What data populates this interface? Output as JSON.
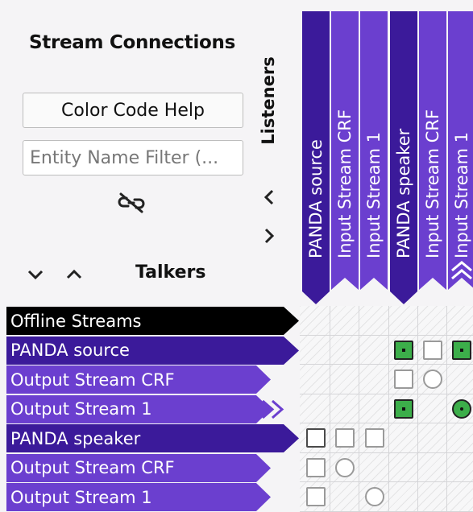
{
  "panel": {
    "title": "Stream Connections",
    "color_code_help_label": "Color Code Help",
    "filter_placeholder": "Entity Name Filter (...",
    "listeners_label": "Listeners",
    "talkers_label": "Talkers"
  },
  "listeners": [
    {
      "label": "PANDA source",
      "color": "#3b1a9a",
      "kind": "entity"
    },
    {
      "label": "Input Stream CRF",
      "color": "#6b3fcf",
      "kind": "stream"
    },
    {
      "label": "Input Stream 1",
      "color": "#6b3fcf",
      "kind": "stream"
    },
    {
      "label": "PANDA speaker",
      "color": "#3b1a9a",
      "kind": "entity"
    },
    {
      "label": "Input Stream CRF",
      "color": "#6b3fcf",
      "kind": "stream"
    },
    {
      "label": "Input Stream 1",
      "color": "#6b3fcf",
      "kind": "stream"
    }
  ],
  "talkers": [
    {
      "label": "Offline Streams",
      "color": "#000000",
      "kind": "offline"
    },
    {
      "label": "PANDA source",
      "color": "#3b1a9a",
      "kind": "entity"
    },
    {
      "label": "Output Stream CRF",
      "color": "#6b3fcf",
      "kind": "stream"
    },
    {
      "label": "Output Stream 1",
      "color": "#6b3fcf",
      "kind": "stream"
    },
    {
      "label": "PANDA speaker",
      "color": "#3b1a9a",
      "kind": "entity"
    },
    {
      "label": "Output Stream CRF",
      "color": "#6b3fcf",
      "kind": "stream"
    },
    {
      "label": "Output Stream 1",
      "color": "#6b3fcf",
      "kind": "stream"
    }
  ],
  "cells": [
    {
      "row": 1,
      "col": 3,
      "shape": "square",
      "state": "connected"
    },
    {
      "row": 1,
      "col": 4,
      "shape": "square",
      "state": "available"
    },
    {
      "row": 1,
      "col": 5,
      "shape": "square",
      "state": "connected"
    },
    {
      "row": 2,
      "col": 3,
      "shape": "square",
      "state": "available"
    },
    {
      "row": 2,
      "col": 4,
      "shape": "circle",
      "state": "available"
    },
    {
      "row": 3,
      "col": 3,
      "shape": "square",
      "state": "connected"
    },
    {
      "row": 3,
      "col": 5,
      "shape": "circle",
      "state": "connected"
    },
    {
      "row": 4,
      "col": 0,
      "shape": "square",
      "state": "available-strong"
    },
    {
      "row": 4,
      "col": 1,
      "shape": "square",
      "state": "available"
    },
    {
      "row": 4,
      "col": 2,
      "shape": "square",
      "state": "available"
    },
    {
      "row": 5,
      "col": 0,
      "shape": "square",
      "state": "available"
    },
    {
      "row": 5,
      "col": 1,
      "shape": "circle",
      "state": "available"
    },
    {
      "row": 6,
      "col": 0,
      "shape": "square",
      "state": "available"
    },
    {
      "row": 6,
      "col": 2,
      "shape": "circle",
      "state": "available"
    }
  ],
  "icons": {
    "unlink": "unlink-icon",
    "collapse_left": "chevron-left-icon",
    "expand_right": "chevron-right-icon",
    "expand_all": "chevron-down-icon",
    "collapse_all": "chevron-up-icon",
    "expanded_marker": "expanded-chevron-icon"
  }
}
